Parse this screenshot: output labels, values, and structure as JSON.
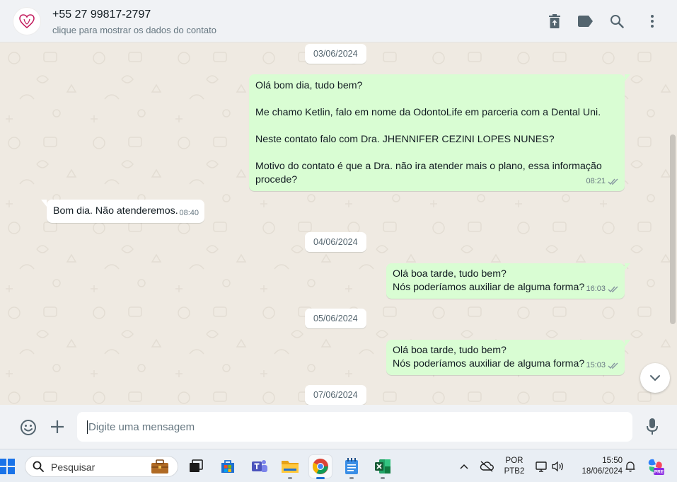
{
  "header": {
    "contact_name": "+55 27 99817-2797",
    "contact_subtitle": "clique para mostrar os dados do contato"
  },
  "conversation": {
    "dates": [
      "03/06/2024",
      "04/06/2024",
      "05/06/2024",
      "07/06/2024"
    ],
    "messages": [
      {
        "direction": "out",
        "lines": [
          "Olá bom dia, tudo bem?",
          "",
          "Me chamo Ketlin, falo em nome da OdontoLife em parceria com a Dental Uni.",
          "",
          "Neste contato falo com Dra. JHENNIFER CEZINI LOPES NUNES?",
          "",
          "Motivo do contato é que a Dra. não ira atender mais o plano, essa informação",
          "procede?"
        ],
        "time": "08:21"
      },
      {
        "direction": "in",
        "lines": [
          "Bom dia. Não atenderemos."
        ],
        "time": "08:40"
      },
      {
        "direction": "out",
        "lines": [
          "Olá boa tarde, tudo bem?",
          "Nós poderíamos auxiliar de alguma forma?"
        ],
        "time": "16:03"
      },
      {
        "direction": "out",
        "lines": [
          "Olá boa tarde, tudo bem?",
          "Nós poderíamos auxiliar de alguma forma?"
        ],
        "time": "15:03"
      }
    ]
  },
  "composer": {
    "placeholder": "Digite uma mensagem"
  },
  "taskbar": {
    "search_placeholder": "Pesquisar",
    "language": "POR",
    "layout": "PTB2",
    "time": "15:50",
    "date": "18/06/2024",
    "copilot_badge": "PRE"
  },
  "colors": {
    "outgoing_bubble": "#d9fdd3",
    "incoming_bubble": "#ffffff",
    "chat_background": "#efeae2",
    "header_background": "#f0f2f5",
    "read_ticks": "#8696a0"
  },
  "icons": {
    "header": [
      "archive-icon",
      "label-icon",
      "search-icon",
      "menu-icon"
    ],
    "composer": [
      "emoji-icon",
      "plus-icon",
      "microphone-icon"
    ],
    "taskbar": [
      "windows-start-icon",
      "search-icon",
      "briefcase-icon",
      "task-view-icon",
      "microsoft-store-icon",
      "teams-icon",
      "file-explorer-icon",
      "chrome-icon",
      "notepad-icon",
      "excel-icon"
    ]
  }
}
